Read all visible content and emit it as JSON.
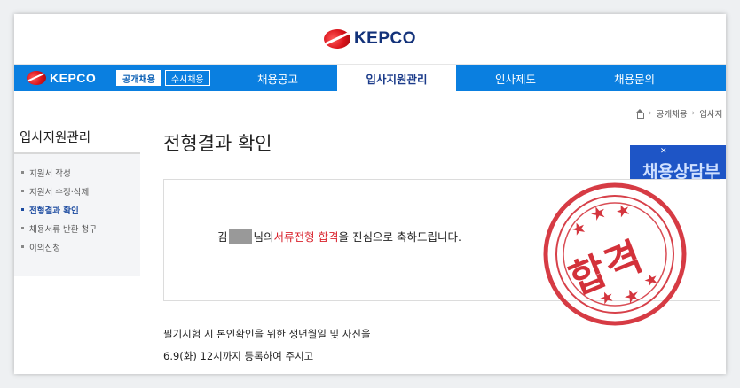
{
  "header": {
    "logo_text": "KEPCO"
  },
  "navbar": {
    "logo_text": "KEPCO",
    "pills": [
      "공개채용",
      "수시채용"
    ],
    "items": [
      "채용공고",
      "입사지원관리",
      "인사제도",
      "채용문의"
    ],
    "active_index": 1
  },
  "breadcrumb": [
    "공개채용",
    "입사지"
  ],
  "sidebar": {
    "title": "입사지원관리",
    "items": [
      "지원서 작성",
      "지원서 수정·삭제",
      "전형결과 확인",
      "채용서류 반환 청구",
      "이의신청"
    ],
    "active_index": 2
  },
  "main": {
    "title": "전형결과 확인",
    "message": {
      "name_initial": "김",
      "part1": "님의 ",
      "highlight": "서류전형 합격",
      "part2": "을 진심으로 축하드립니다."
    },
    "notice_lines": [
      "필기시험 시 본인확인을 위한 생년월일 및 사진을",
      "6.9(화) 12시까지 등록하여 주시고"
    ]
  },
  "banner": {
    "text": "채용상담부",
    "close": "✕"
  },
  "stamp": {
    "text": "합격"
  },
  "colors": {
    "nav_blue": "#0a7fe0",
    "accent_red": "#d9232d",
    "brand_navy": "#13327a",
    "banner_blue": "#1e55c6"
  }
}
